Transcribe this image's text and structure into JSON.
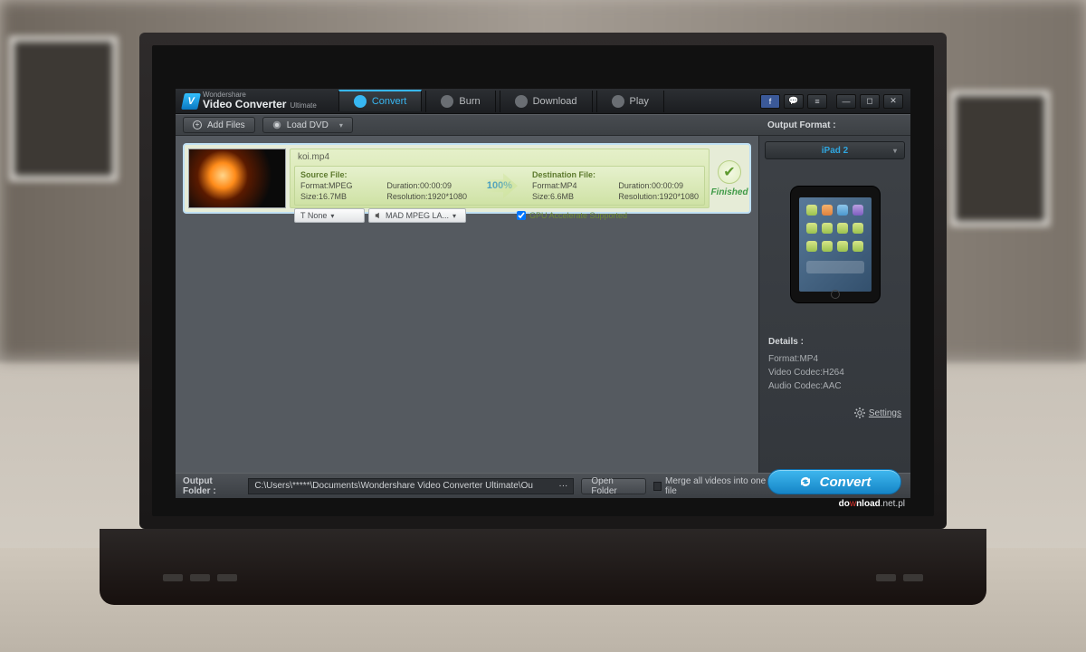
{
  "brand": {
    "small": "Wondershare",
    "big": "Video Converter",
    "edition": "Ultimate"
  },
  "tabs": [
    {
      "label": "Convert"
    },
    {
      "label": "Burn"
    },
    {
      "label": "Download"
    },
    {
      "label": "Play"
    }
  ],
  "toolbar": {
    "add_files": "Add Files",
    "load_dvd": "Load DVD"
  },
  "side": {
    "header": "Output Format :",
    "format": "iPad 2",
    "details_h": "Details :",
    "d_format": "Format:MP4",
    "d_vc": "Video Codec:H264",
    "d_ac": "Audio Codec:AAC",
    "settings": "Settings"
  },
  "item": {
    "filename": "koi.mp4",
    "src_h": "Source File:",
    "src_format": "Format:MPEG",
    "src_size": "Size:16.7MB",
    "src_dur": "Duration:00:00:09",
    "src_res": "Resolution:1920*1080",
    "pct": "100%",
    "dst_h": "Destination File:",
    "dst_format": "Format:MP4",
    "dst_size": "Size:6.6MB",
    "dst_dur": "Duration:00:00:09",
    "dst_res": "Resolution:1920*1080",
    "sub": "T None",
    "audio": "MAD MPEG LA...",
    "gpu": "GPU Accelerate Supported",
    "status": "Finished"
  },
  "status": {
    "label": "Output Folder :",
    "path": "C:\\Users\\*****\\Documents\\Wondershare Video Converter Ultimate\\Ou",
    "open": "Open Folder",
    "merge": "Merge all videos into one file",
    "convert": "Convert"
  },
  "watermark": {
    "a": "do",
    "b": "w",
    "c": "nload",
    "d": ".net.pl"
  }
}
